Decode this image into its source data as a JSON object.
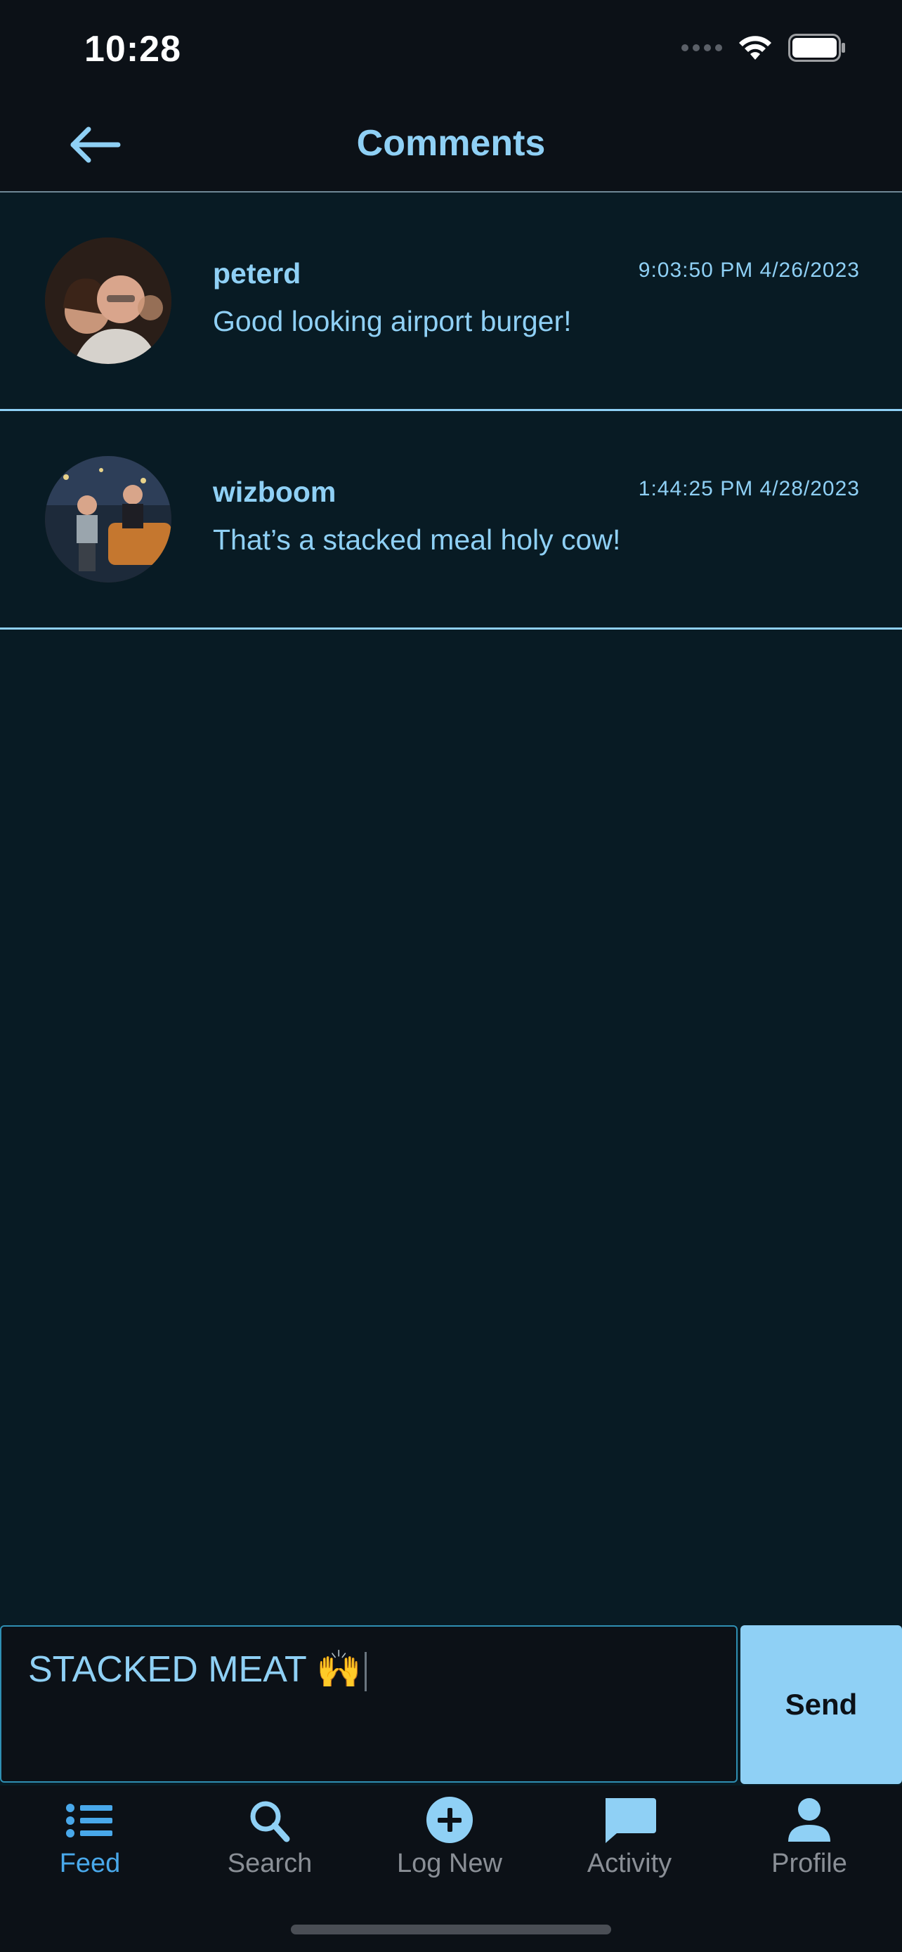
{
  "status_bar": {
    "time": "10:28"
  },
  "header": {
    "title": "Comments"
  },
  "comments": [
    {
      "username": "peterd",
      "timestamp": "9:03:50 PM 4/26/2023",
      "text": "Good looking airport burger!"
    },
    {
      "username": "wizboom",
      "timestamp": "1:44:25 PM 4/28/2023",
      "text": "That’s a stacked meal holy cow!"
    }
  ],
  "composer": {
    "value": "STACKED MEAT 🙌",
    "send_label": "Send"
  },
  "tabs": [
    {
      "label": "Feed",
      "icon": "list-icon",
      "active": true
    },
    {
      "label": "Search",
      "icon": "search-icon",
      "active": false
    },
    {
      "label": "Log New",
      "icon": "add-circle-icon",
      "active": false
    },
    {
      "label": "Activity",
      "icon": "chat-bubble-icon",
      "active": false
    },
    {
      "label": "Profile",
      "icon": "person-icon",
      "active": false
    }
  ],
  "colors": {
    "accent": "#8fd0f5",
    "active_tab": "#49a8ea",
    "background": "#081b24",
    "bar": "#0c1117"
  }
}
